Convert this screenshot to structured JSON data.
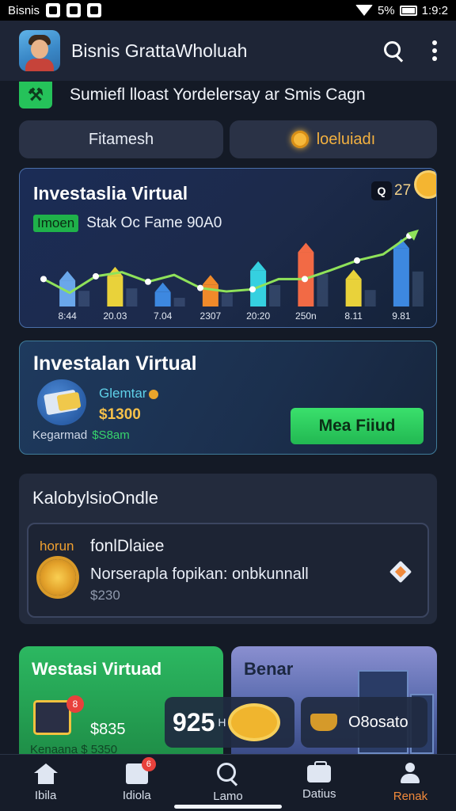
{
  "status_bar": {
    "left_text": "Bisnis",
    "battery": "5%",
    "time": "1:9:2"
  },
  "app_bar": {
    "title": "Bisnis GrattaWholuah"
  },
  "banner": {
    "text": "Sumiefl lloast Yordelersay ar Smis Cagn"
  },
  "pills": {
    "left": "Fitamesh",
    "right": "loeluiadı"
  },
  "chart_card": {
    "title": "Investaslia Virtual",
    "tag": "Imoen",
    "subtitle": "Stak Oc Fame 90A0",
    "camera_label": "Q",
    "count": "27",
    "accent": "#f6b93b"
  },
  "chart_data": {
    "type": "bar",
    "categories": [
      "8:44",
      "20.03",
      "7.04",
      "2307",
      "20:20",
      "250n",
      "8.11",
      "9.81"
    ],
    "series": [
      {
        "values": [
          38,
          44,
          21,
          32,
          52,
          79,
          40,
          85
        ],
        "colors": [
          "#6aa7ea",
          "#e9d23a",
          "#3d88e0",
          "#f08a2a",
          "#35d0e0",
          "#f26a45",
          "#e9d23a",
          "#3d88e0"
        ]
      }
    ],
    "line": [
      40,
      20,
      44,
      50,
      36,
      46,
      27,
      22,
      25,
      40,
      40,
      53,
      67,
      76,
      103
    ],
    "line_color": "#8fe25a",
    "ylim": [
      0,
      120
    ]
  },
  "invest_card": {
    "title": "Investalan Virtual",
    "label_top": "Glemtar",
    "amount": "$1300",
    "label_bottom": "Kegarmad",
    "label_bottom_value": "$S8am",
    "button": "Mea Fiiud"
  },
  "list_card": {
    "title": "KalobylsioOndle",
    "item": {
      "kicker": "horun",
      "name": "fonlDlaiee",
      "desc": "Norserapla fopikan: onbkunnall",
      "price": "$230"
    }
  },
  "promos": {
    "left": {
      "title": "Westasi Virtuad",
      "value": "$835",
      "cut": "Kenaana  $ 5350"
    },
    "right": {
      "title": "Benar"
    }
  },
  "overlays": {
    "left": {
      "big": "925",
      "small": "H"
    },
    "right": {
      "value": "O8osato"
    }
  },
  "bottom_nav": [
    {
      "label": "Ibila",
      "icon": "home-icon"
    },
    {
      "label": "Idiola",
      "icon": "gift-icon",
      "badge": "6"
    },
    {
      "label": "Lamo",
      "icon": "search-icon"
    },
    {
      "label": "Datius",
      "icon": "briefcase-icon"
    },
    {
      "label": "Renak",
      "icon": "user-icon",
      "active": true
    }
  ]
}
